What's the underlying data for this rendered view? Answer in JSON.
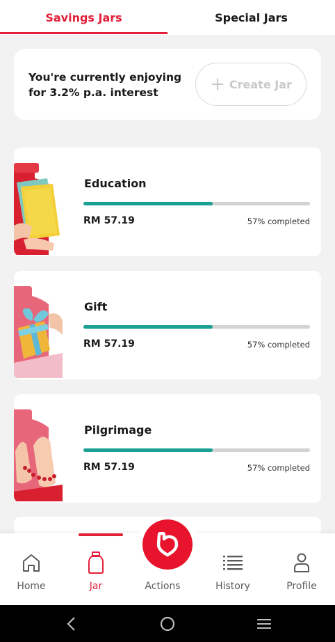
{
  "tabs": [
    {
      "label": "Savings Jars",
      "active": true
    },
    {
      "label": "Special Jars",
      "active": false
    }
  ],
  "interest_card": {
    "text": "You're currently enjoying for 3.2% p.a. interest",
    "create_button": {
      "plus": "+",
      "label": "Create Jar"
    }
  },
  "jars": [
    {
      "title": "Education",
      "amount": "RM 57.19",
      "status": "57% completed",
      "progress": 0.57,
      "icon": "books-icon"
    },
    {
      "title": "Gift",
      "amount": "RM 57.19",
      "status": "57% completed",
      "progress": 0.57,
      "icon": "gift-box-icon"
    },
    {
      "title": "Pilgrimage",
      "amount": "RM 57.19",
      "status": "57% completed",
      "progress": 0.57,
      "icon": "prayer-beads-icon"
    }
  ],
  "bottom_nav": {
    "items": [
      {
        "label": "Home",
        "icon": "home-icon"
      },
      {
        "label": "Jar",
        "icon": "jar-icon",
        "active": true
      },
      {
        "label": "Actions",
        "icon": "heart-logo-icon"
      },
      {
        "label": "History",
        "icon": "list-icon"
      },
      {
        "label": "Profile",
        "icon": "person-icon"
      }
    ]
  },
  "colors": {
    "accent": "#e2203a",
    "progress": "#1aa193",
    "track": "#d3d3d3",
    "background": "#f2f2f2"
  }
}
